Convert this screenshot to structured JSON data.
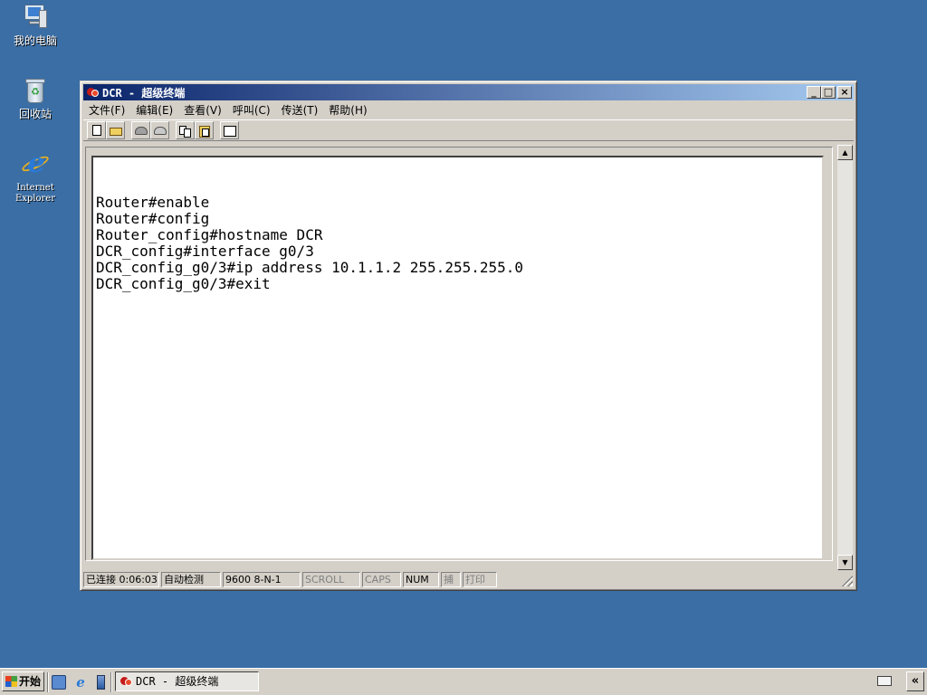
{
  "desktop": {
    "icons": [
      {
        "label": "我的电脑",
        "icon": "my-computer-icon"
      },
      {
        "label": "回收站",
        "icon": "recycle-bin-icon"
      },
      {
        "label": "Internet\nExplorer",
        "icon": "internet-explorer-icon"
      }
    ]
  },
  "window": {
    "title": "DCR - 超级终端",
    "controls": {
      "minimize": "_",
      "maximize": "□",
      "close": "×"
    },
    "menu": [
      "文件(F)",
      "编辑(E)",
      "查看(V)",
      "呼叫(C)",
      "传送(T)",
      "帮助(H)"
    ],
    "toolbar_icons": [
      "new-document-icon",
      "open-folder-icon",
      "call-icon",
      "disconnect-icon",
      "send-file-icon",
      "receive-file-icon",
      "properties-icon"
    ],
    "terminal_lines": [
      "Router#enable",
      "Router#config",
      "Router_config#hostname DCR",
      "DCR_config#interface g0/3",
      "DCR_config_g0/3#ip address 10.1.1.2 255.255.255.0",
      "DCR_config_g0/3#exit"
    ],
    "scrollbar": {
      "up": "▲",
      "down": "▼"
    },
    "status": {
      "connected": "已连接 0:06:03",
      "detect": "自动检测",
      "params": "9600 8-N-1",
      "scroll": "SCROLL",
      "caps": "CAPS",
      "num": "NUM",
      "capture": "捕",
      "print": "打印"
    }
  },
  "taskbar": {
    "start_label": "开始",
    "task_title": "DCR - 超级终端",
    "tray_toggle": "«",
    "colors": {
      "background": "#d4d0c8",
      "desktop": "#3a6ea5",
      "titlebar_start": "#0a246a",
      "titlebar_end": "#a6caf0"
    }
  }
}
